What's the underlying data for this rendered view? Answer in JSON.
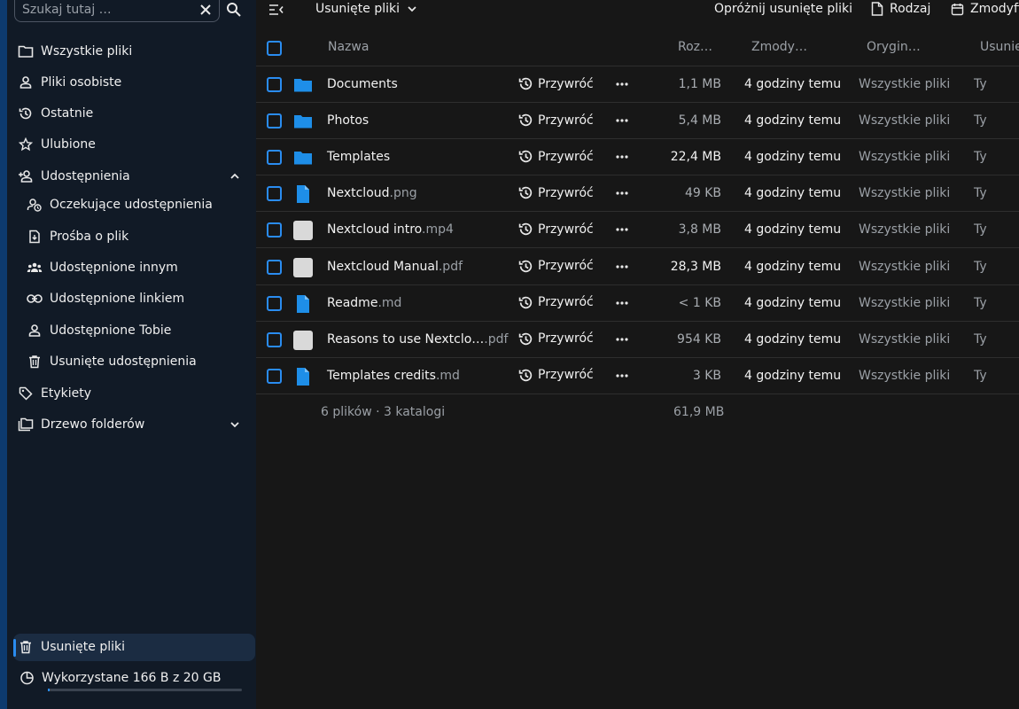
{
  "search": {
    "placeholder": "Szukaj tutaj …"
  },
  "sidebar": {
    "items": [
      {
        "label": "Wszystkie pliki",
        "icon": "folder-icon"
      },
      {
        "label": "Pliki osobiste",
        "icon": "user-icon"
      },
      {
        "label": "Ostatnie",
        "icon": "history-icon"
      },
      {
        "label": "Ulubione",
        "icon": "star-icon"
      },
      {
        "label": "Udostępnienia",
        "icon": "share-user-icon"
      },
      {
        "label": "Oczekujące udostępnienia",
        "icon": "pending-share-icon"
      },
      {
        "label": "Prośba o plik",
        "icon": "file-request-icon"
      },
      {
        "label": "Udostępnione innym",
        "icon": "group-icon"
      },
      {
        "label": "Udostępnione linkiem",
        "icon": "link-icon"
      },
      {
        "label": "Udostępnione Tobie",
        "icon": "user-icon"
      },
      {
        "label": "Usunięte udostępnienia",
        "icon": "trash-icon"
      },
      {
        "label": "Etykiety",
        "icon": "tag-icon"
      },
      {
        "label": "Drzewo folderów",
        "icon": "folder-tree-icon"
      }
    ],
    "trash_label": "Usunięte pliki",
    "quota_label": "Wykorzystane 166 B z 20 GB",
    "quota_fraction": 0.01
  },
  "topbar": {
    "view_title": "Usunięte pliki",
    "empty_trash": "Opróżnij usunięte pliki",
    "type_filter": "Rodzaj",
    "modified_filter": "Zmodyfi"
  },
  "table": {
    "headers": {
      "name": "Nazwa",
      "size": "Roz…",
      "modified": "Zmody…",
      "original": "Orygin…",
      "deleted_by": "Usunię"
    },
    "restore_label": "Przywróć",
    "rows": [
      {
        "base": "Documents",
        "ext": "",
        "type": "folder",
        "size": "1,1 MB",
        "size_bold": false,
        "modified": "4 godziny temu",
        "original": "Wszystkie pliki",
        "deleted_by": "Ty"
      },
      {
        "base": "Photos",
        "ext": "",
        "type": "folder",
        "size": "5,4 MB",
        "size_bold": false,
        "modified": "4 godziny temu",
        "original": "Wszystkie pliki",
        "deleted_by": "Ty"
      },
      {
        "base": "Templates",
        "ext": "",
        "type": "folder",
        "size": "22,4 MB",
        "size_bold": true,
        "modified": "4 godziny temu",
        "original": "Wszystkie pliki",
        "deleted_by": "Ty"
      },
      {
        "base": "Nextcloud",
        "ext": ".png",
        "type": "file",
        "size": "49 KB",
        "size_bold": false,
        "modified": "4 godziny temu",
        "original": "Wszystkie pliki",
        "deleted_by": "Ty"
      },
      {
        "base": "Nextcloud intro",
        "ext": ".mp4",
        "type": "blank",
        "size": "3,8 MB",
        "size_bold": false,
        "modified": "4 godziny temu",
        "original": "Wszystkie pliki",
        "deleted_by": "Ty"
      },
      {
        "base": "Nextcloud Manual",
        "ext": ".pdf",
        "type": "blank",
        "size": "28,3 MB",
        "size_bold": true,
        "modified": "4 godziny temu",
        "original": "Wszystkie pliki",
        "deleted_by": "Ty"
      },
      {
        "base": "Readme",
        "ext": ".md",
        "type": "file",
        "size": "< 1 KB",
        "size_bold": false,
        "modified": "4 godziny temu",
        "original": "Wszystkie pliki",
        "deleted_by": "Ty"
      },
      {
        "base": "Reasons to use Nextclo…",
        "ext": ".pdf",
        "type": "blank",
        "size": "954 KB",
        "size_bold": false,
        "modified": "4 godziny temu",
        "original": "Wszystkie pliki",
        "deleted_by": "Ty"
      },
      {
        "base": "Templates credits",
        "ext": ".md",
        "type": "file",
        "size": "3 KB",
        "size_bold": false,
        "modified": "4 godziny temu",
        "original": "Wszystkie pliki",
        "deleted_by": "Ty"
      }
    ],
    "summary": {
      "count": "6 plików · 3 katalogi",
      "total": "61,9 MB"
    }
  },
  "colors": {
    "accent": "#2a8cf0",
    "sidebar_bg": "#111a26",
    "main_bg": "#171717",
    "folder": "#1e8ee8",
    "blank_file": "#d9d9d9"
  }
}
